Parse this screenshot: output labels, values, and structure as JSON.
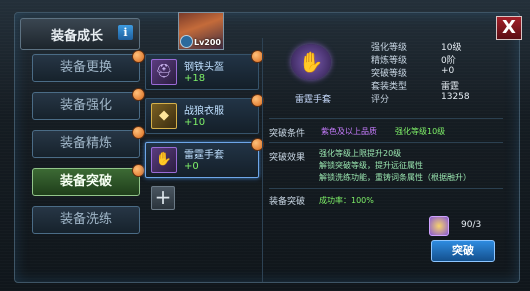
{
  "header": {
    "title": "装备成长",
    "info_icon": "i",
    "close_icon": "X",
    "avatar_level": "Lv200"
  },
  "menu": [
    {
      "label": "装备更换",
      "active": false
    },
    {
      "label": "装备强化",
      "active": false
    },
    {
      "label": "装备精炼",
      "active": false
    },
    {
      "label": "装备突破",
      "active": true
    },
    {
      "label": "装备洗练",
      "active": false
    }
  ],
  "items": [
    {
      "name": "钢铁头盔",
      "value": "+18",
      "icon": "helmet-icon"
    },
    {
      "name": "战狼衣服",
      "value": "+10",
      "icon": "armor-icon"
    },
    {
      "name": "雷霆手套",
      "value": "+0",
      "icon": "glove-icon"
    }
  ],
  "equipment": {
    "name": "雷霆手套",
    "stats": [
      {
        "label": "强化等级",
        "value": "10级"
      },
      {
        "label": "精炼等级",
        "value": "0阶"
      },
      {
        "label": "突破等级",
        "value": "+0"
      },
      {
        "label": "套装类型",
        "value": "雷霆"
      },
      {
        "label": "评分",
        "value": "13258"
      }
    ]
  },
  "breakthrough": {
    "condition_label": "突破条件",
    "condition_quality": "紫色及以上品质",
    "condition_level": "强化等级10级",
    "effect_label": "突破效果",
    "effects": [
      "强化等级上限提升20级",
      "解锁突破等级，提升远征属性",
      "解锁洗练功能，重铸词条属性（根据融升）"
    ],
    "break_label": "装备突破",
    "success_rate": "成功率：100%",
    "material_count": "90/3",
    "button_label": "突破"
  },
  "colors": {
    "accent_blue": "#2e8be0",
    "active_green": "#3c6a34",
    "purple_text": "#c77cff",
    "green_text": "#7ef068"
  }
}
